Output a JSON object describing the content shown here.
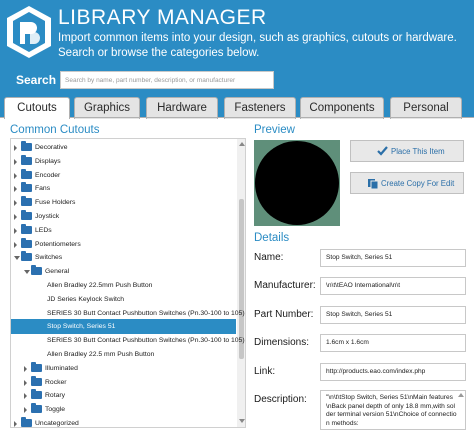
{
  "header": {
    "title": "LIBRARY MANAGER",
    "subtitle": "Import common items into your design, such as graphics, cutouts or hardware. Search or browse the categories below.",
    "bg_color": "#2b8cc4"
  },
  "search": {
    "label": "Search",
    "placeholder": "Search by name, part number, description, or manufacturer"
  },
  "tabs": [
    {
      "label": "Cutouts",
      "active": true
    },
    {
      "label": "Graphics",
      "active": false
    },
    {
      "label": "Hardware",
      "active": false
    },
    {
      "label": "Fasteners",
      "active": false
    },
    {
      "label": "Components",
      "active": false
    },
    {
      "label": "Personal",
      "active": false
    }
  ],
  "left": {
    "title": "Common Cutouts",
    "tree": [
      {
        "label": "Decorative",
        "level": 1,
        "folder": true,
        "expanded": false,
        "selected": false
      },
      {
        "label": "Displays",
        "level": 1,
        "folder": true,
        "expanded": false,
        "selected": false
      },
      {
        "label": "Encoder",
        "level": 1,
        "folder": true,
        "expanded": false,
        "selected": false
      },
      {
        "label": "Fans",
        "level": 1,
        "folder": true,
        "expanded": false,
        "selected": false
      },
      {
        "label": "Fuse Holders",
        "level": 1,
        "folder": true,
        "expanded": false,
        "selected": false
      },
      {
        "label": "Joystick",
        "level": 1,
        "folder": true,
        "expanded": false,
        "selected": false
      },
      {
        "label": "LEDs",
        "level": 1,
        "folder": true,
        "expanded": false,
        "selected": false
      },
      {
        "label": "Potentiometers",
        "level": 1,
        "folder": true,
        "expanded": false,
        "selected": false
      },
      {
        "label": "Switches",
        "level": 1,
        "folder": true,
        "expanded": true,
        "selected": false
      },
      {
        "label": "General",
        "level": 2,
        "folder": true,
        "expanded": true,
        "selected": false
      },
      {
        "label": "Allen Bradley 22.5mm Push Button",
        "level": 3,
        "folder": false,
        "expanded": false,
        "selected": false
      },
      {
        "label": "JD Series Keylock Switch",
        "level": 3,
        "folder": false,
        "expanded": false,
        "selected": false
      },
      {
        "label": "SERIES 30 Butt Contact Pushbutton Switches (Pn.30-100 to 105)",
        "level": 3,
        "folder": false,
        "expanded": false,
        "selected": false
      },
      {
        "label": "Stop Switch, Series 51",
        "level": 3,
        "folder": false,
        "expanded": false,
        "selected": true
      },
      {
        "label": "SERIES 30 Butt Contact Pushbutton Switches (Pn.30-100 to 105)",
        "level": 3,
        "folder": false,
        "expanded": false,
        "selected": false
      },
      {
        "label": "Allen Bradley 22.5 mm Push Button",
        "level": 3,
        "folder": false,
        "expanded": false,
        "selected": false
      },
      {
        "label": "Illuminated",
        "level": 2,
        "folder": true,
        "expanded": false,
        "selected": false
      },
      {
        "label": "Rocker",
        "level": 2,
        "folder": true,
        "expanded": false,
        "selected": false
      },
      {
        "label": "Rotary",
        "level": 2,
        "folder": true,
        "expanded": false,
        "selected": false
      },
      {
        "label": "Toggle",
        "level": 2,
        "folder": true,
        "expanded": false,
        "selected": false
      },
      {
        "label": "Uncategorized",
        "level": 1,
        "folder": true,
        "expanded": false,
        "selected": false
      }
    ]
  },
  "preview": {
    "title": "Preview",
    "place_button": "Place This Item",
    "copy_button": "Create Copy For Edit"
  },
  "details": {
    "title": "Details",
    "name_label": "Name:",
    "name_value": "Stop Switch, Series 51",
    "manufacturer_label": "Manufacturer:",
    "manufacturer_value": "\\n\\t\\tEAO International\\n\\t",
    "part_label": "Part Number:",
    "part_value": "Stop Switch, Series 51",
    "dimensions_label": "Dimensions:",
    "dimensions_value": "1.6cm x 1.6cm",
    "link_label": "Link:",
    "link_value": "http://products.eao.com/index.php",
    "description_label": "Description:",
    "description_value": "\"\\n\\t\\tStop Switch, Series 51\\nMain features\\nBack panel depth of only 18.8 mm,with solder terminal version 51\\nChoice of connection methods:"
  },
  "colors": {
    "accent": "#2b8cc4",
    "folder": "#2b70b0",
    "preview_bg": "#5f8f7a"
  }
}
